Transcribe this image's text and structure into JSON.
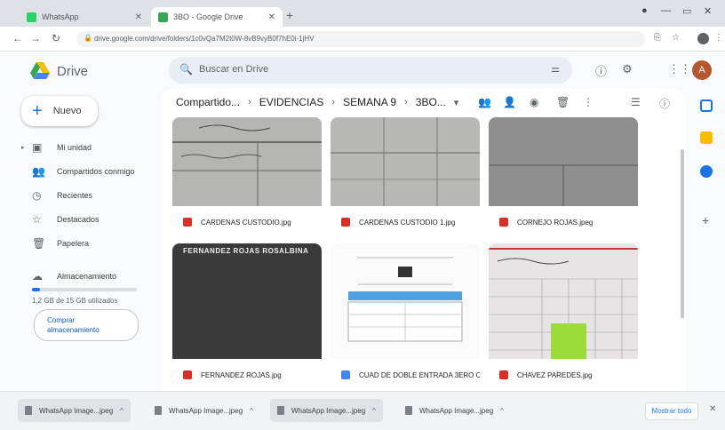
{
  "browser": {
    "tabs": [
      {
        "label": "WhatsApp",
        "favicon_color": "#25d366"
      },
      {
        "label": "3BO - Google Drive",
        "favicon_color": "#34a853"
      }
    ],
    "new_tab": "+",
    "address": "drive.google.com/drive/folders/1c0vQa7M2t0W-8vB9vyB0f7hE0i-1jHV"
  },
  "drive": {
    "logo_text": "Drive",
    "search_placeholder": "Buscar en Drive",
    "new_button": "Nuevo",
    "avatar_initial": "A",
    "nav": [
      {
        "label": "Mi unidad",
        "icon": "my-drive-icon",
        "glyph": "▣",
        "caret": true
      },
      {
        "label": "Compartidos conmigo",
        "icon": "shared-icon",
        "glyph": "👥"
      },
      {
        "label": "Recientes",
        "icon": "clock-icon",
        "glyph": "◷"
      },
      {
        "label": "Destacados",
        "icon": "star-icon",
        "glyph": "☆"
      },
      {
        "label": "Papelera",
        "icon": "trash-icon",
        "glyph": "🗑"
      }
    ],
    "storage": {
      "label": "Almacenamiento",
      "used_text": "1,2 GB de 15 GB utilizados",
      "used_fraction": 0.08,
      "buy_line1": "Comprar",
      "buy_line2": "almacenamiento"
    },
    "breadcrumb": [
      "Compartido...",
      "EVIDENCIAS",
      "SEMANA 9",
      "3BO..."
    ],
    "files": [
      {
        "name": "CARDENAS CUSTODIO.jpg",
        "type": "image",
        "type_color": "#d93025",
        "thumb": "paper-lines"
      },
      {
        "name": "CARDENAS CUSTODIO 1.jpg",
        "type": "image",
        "type_color": "#d93025",
        "thumb": "paper-grid"
      },
      {
        "name": "CORNEJO ROJAS.jpeg",
        "type": "image",
        "type_color": "#d93025",
        "thumb": "paper-dark"
      },
      {
        "name": "FERNANDEZ ROJAS.jpg",
        "type": "image",
        "type_color": "#d93025",
        "thumb": "dark-photo",
        "thumb_text": "FERNANDEZ ROJAS ROSALBINA"
      },
      {
        "name": "CUAD DE DOBLE ENTRADA 3ERO C...",
        "type": "doc",
        "type_color": "#4285f4",
        "thumb": "document"
      },
      {
        "name": "CHAVEZ PAREDES.jpg",
        "type": "image",
        "type_color": "#d93025",
        "thumb": "notebook-green"
      }
    ]
  },
  "downloads": {
    "items": [
      {
        "name": "WhatsApp Image...jpeg"
      },
      {
        "name": "WhatsApp Image...jpeg"
      },
      {
        "name": "WhatsApp Image...jpeg"
      },
      {
        "name": "WhatsApp Image...jpeg"
      }
    ],
    "show_all": "Mostrar todo"
  }
}
